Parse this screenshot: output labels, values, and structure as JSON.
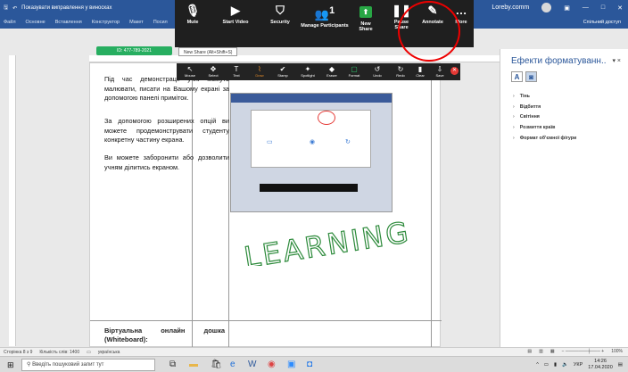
{
  "word": {
    "title": "Показувати виправлення у виносках",
    "account": "Loreby.comm",
    "ribbon_tabs": [
      "Файл",
      "Основне",
      "Вставлення",
      "Конструктор",
      "Макет",
      "Посил"
    ],
    "share": "Спільний доступ"
  },
  "zoom_toolbar": {
    "items": [
      {
        "label": "Mute",
        "icon": "microphone-icon"
      },
      {
        "label": "Start Video",
        "icon": "video-icon"
      },
      {
        "label": "Security",
        "icon": "shield-icon"
      },
      {
        "label": "Manage Participants",
        "icon": "participants-icon",
        "count": "1"
      },
      {
        "label": "New Share",
        "icon": "new-share-icon"
      },
      {
        "label": "Pause Share",
        "icon": "pause-icon"
      },
      {
        "label": "Annotate",
        "icon": "pencil-icon"
      },
      {
        "label": "More",
        "icon": "more-icon"
      }
    ],
    "meeting_id": "ID: 477-789-2021",
    "new_share_tip": "New Share (Alt+Shift+S)"
  },
  "annotation_toolbar": {
    "tools": [
      "Mouse",
      "Select",
      "Text",
      "Draw",
      "Stamp",
      "Spotlight",
      "Eraser",
      "Format",
      "Undo",
      "Redo",
      "Clear",
      "Save"
    ]
  },
  "document": {
    "paragraphs": [
      "Під час демонстрації учні можуть малювати, писати на Вашому екрані за допомогою панелі приміток.",
      "За допомогою розширених опцій ви можете продемонструвати студенту конкретну частину екрана.",
      "Ви можете заборонити або дозволити учням ділитись екраном."
    ],
    "bottom_cell_line1": "Віртуальна онлайн дошка",
    "bottom_cell_line2": "(Whiteboard):",
    "handwriting": "LEARNING",
    "handwriting_color": "#2e8b3c"
  },
  "format_pane": {
    "title": "Ефекти форматуванн..",
    "close": "×",
    "items": [
      "Тінь",
      "Відбиття",
      "Світіння",
      "Розмиття країв",
      "Формат об'ємної фігури"
    ]
  },
  "statusbar": {
    "page": "Сторінка 8 з 9",
    "words": "Кількість слів: 1400",
    "language": "українська",
    "zoom": "100%"
  },
  "taskbar": {
    "search_placeholder": "Введіть пошуковий запит тут",
    "language": "УКР",
    "time": "14:26",
    "date": "17.04.2020"
  },
  "colors": {
    "word_blue": "#2b579a",
    "zoom_dark": "#1f1f1f",
    "highlight_red": "#e00000"
  }
}
